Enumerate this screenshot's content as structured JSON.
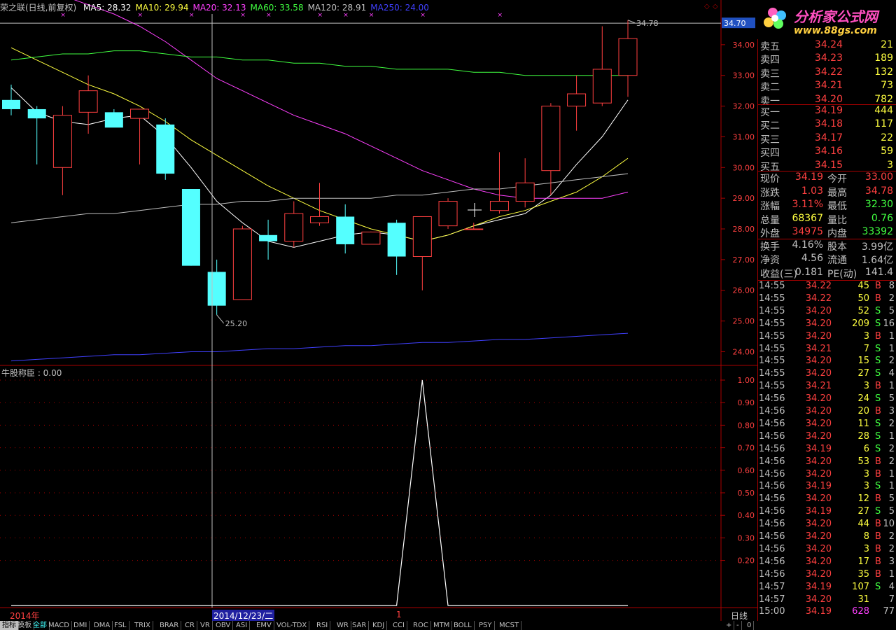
{
  "window": {
    "stock_title": "荣之联(日线,前复权)",
    "ma": [
      {
        "label": "MA5: 28.32",
        "color": "#ffffff"
      },
      {
        "label": "MA10: 29.94",
        "color": "#ffff40"
      },
      {
        "label": "MA20: 32.13",
        "color": "#ff40ff"
      },
      {
        "label": "MA60: 33.58",
        "color": "#40ff40"
      },
      {
        "label": "MA120: 28.91",
        "color": "#c0c0c0"
      },
      {
        "label": "MA250: 24.00",
        "color": "#4040ff"
      }
    ]
  },
  "price_axis": {
    "ticks": [
      "34.00",
      "33.00",
      "32.00",
      "31.00",
      "30.00",
      "29.00",
      "28.00",
      "27.00",
      "26.00",
      "25.00",
      "24.00"
    ],
    "current_marker": "34.70",
    "high_label": "34.78",
    "low_label": "25.20"
  },
  "indicator": {
    "title": "牛股称臣 : 0.00",
    "ticks": [
      "1.00",
      "0.90",
      "0.80",
      "0.70",
      "0.60",
      "0.50",
      "0.40",
      "0.30",
      "0.20"
    ],
    "series_values": [
      0,
      0,
      0,
      0,
      0,
      0,
      0,
      0,
      0,
      0,
      0,
      0,
      0,
      0,
      0,
      0,
      1,
      0,
      0,
      0,
      0,
      0,
      0,
      0,
      0
    ]
  },
  "date_axis": {
    "year_label": "2014年",
    "cursor_date": "2014/12/23/二",
    "month_label": "1",
    "period": "日线"
  },
  "chart_data": {
    "type": "candlestick",
    "title": "荣之联(日线,前复权)",
    "ylim": [
      23.6,
      35.0
    ],
    "candles": [
      {
        "o": 32.2,
        "h": 32.7,
        "l": 31.7,
        "c": 31.9
      },
      {
        "o": 31.9,
        "h": 32.0,
        "l": 30.1,
        "c": 31.6
      },
      {
        "o": 30.0,
        "h": 32.0,
        "l": 29.1,
        "c": 31.7
      },
      {
        "o": 31.8,
        "h": 33.0,
        "l": 31.1,
        "c": 32.5
      },
      {
        "o": 31.8,
        "h": 31.9,
        "l": 31.4,
        "c": 31.3
      },
      {
        "o": 31.6,
        "h": 31.8,
        "l": 30.1,
        "c": 31.9
      },
      {
        "o": 31.4,
        "h": 31.6,
        "l": 29.6,
        "c": 29.8
      },
      {
        "o": 29.3,
        "h": 29.3,
        "l": 26.8,
        "c": 26.8
      },
      {
        "o": 26.6,
        "h": 27.0,
        "l": 25.2,
        "c": 25.5
      },
      {
        "o": 25.7,
        "h": 28.1,
        "l": 25.7,
        "c": 28.0
      },
      {
        "o": 27.8,
        "h": 28.3,
        "l": 27.0,
        "c": 27.6
      },
      {
        "o": 27.6,
        "h": 28.9,
        "l": 27.4,
        "c": 28.5
      },
      {
        "o": 28.2,
        "h": 29.5,
        "l": 28.1,
        "c": 28.4
      },
      {
        "o": 28.4,
        "h": 28.8,
        "l": 27.2,
        "c": 27.5
      },
      {
        "o": 27.5,
        "h": 27.9,
        "l": 27.5,
        "c": 27.9
      },
      {
        "o": 28.2,
        "h": 28.3,
        "l": 26.5,
        "c": 27.1
      },
      {
        "o": 27.1,
        "h": 28.4,
        "l": 26.0,
        "c": 28.4
      },
      {
        "o": 28.1,
        "h": 29.0,
        "l": 28.0,
        "c": 28.9
      },
      {
        "o": 28.0,
        "h": 28.2,
        "l": 28.0,
        "c": 28.0
      },
      {
        "o": 28.6,
        "h": 30.5,
        "l": 28.5,
        "c": 28.9
      },
      {
        "o": 28.9,
        "h": 30.3,
        "l": 28.7,
        "c": 29.5
      },
      {
        "o": 29.9,
        "h": 32.1,
        "l": 29.1,
        "c": 32.0
      },
      {
        "o": 32.0,
        "h": 33.0,
        "l": 31.2,
        "c": 32.4
      },
      {
        "o": 32.1,
        "h": 34.6,
        "l": 32.0,
        "c": 33.2
      },
      {
        "o": 33.0,
        "h": 34.8,
        "l": 32.3,
        "c": 34.2
      }
    ],
    "ma_lines": [
      {
        "name": "MA5",
        "color": "#ffffff",
        "values": [
          32.6,
          31.8,
          31.5,
          31.4,
          31.6,
          31.7,
          31.0,
          30.0,
          28.9,
          28.2,
          27.6,
          27.4,
          27.6,
          27.8,
          27.9,
          27.8,
          27.6,
          27.8,
          28.1,
          28.3,
          28.5,
          29.1,
          30.1,
          31.0,
          32.2
        ]
      },
      {
        "name": "MA10",
        "color": "#ffff40",
        "values": [
          33.9,
          33.5,
          33.1,
          32.7,
          32.4,
          32.0,
          31.5,
          30.9,
          30.4,
          29.9,
          29.4,
          29.0,
          28.6,
          28.3,
          28.0,
          27.8,
          27.6,
          27.8,
          28.1,
          28.4,
          28.6,
          28.9,
          29.2,
          29.7,
          30.3
        ]
      },
      {
        "name": "MA20",
        "color": "#ff40ff",
        "values": [
          36.1,
          35.9,
          35.6,
          35.3,
          35.0,
          34.6,
          34.1,
          33.5,
          32.9,
          32.5,
          32.1,
          31.7,
          31.4,
          31.1,
          30.7,
          30.3,
          29.9,
          29.6,
          29.3,
          29.1,
          29.0,
          29.0,
          29.0,
          29.0,
          29.2
        ]
      },
      {
        "name": "MA60",
        "color": "#40ff40",
        "values": [
          33.5,
          33.6,
          33.7,
          33.7,
          33.8,
          33.8,
          33.7,
          33.6,
          33.6,
          33.5,
          33.5,
          33.4,
          33.4,
          33.3,
          33.3,
          33.2,
          33.2,
          33.2,
          33.1,
          33.1,
          33.0,
          33.0,
          33.0,
          33.0,
          33.0
        ]
      },
      {
        "name": "MA120",
        "color": "#c0c0c0",
        "values": [
          28.2,
          28.3,
          28.4,
          28.5,
          28.5,
          28.6,
          28.7,
          28.8,
          28.8,
          28.9,
          28.9,
          29.0,
          29.0,
          29.0,
          29.0,
          29.1,
          29.1,
          29.2,
          29.3,
          29.3,
          29.4,
          29.5,
          29.6,
          29.7,
          29.8
        ]
      },
      {
        "name": "MA250",
        "color": "#4040ff",
        "values": [
          23.7,
          23.75,
          23.8,
          23.85,
          23.9,
          23.9,
          23.95,
          24.0,
          24.0,
          24.05,
          24.1,
          24.1,
          24.15,
          24.2,
          24.2,
          24.25,
          24.3,
          24.3,
          24.35,
          24.4,
          24.4,
          24.45,
          24.5,
          24.55,
          24.6
        ]
      }
    ]
  },
  "quote": {
    "asks": [
      {
        "label": "卖五",
        "price": "34.24",
        "vol": "21"
      },
      {
        "label": "卖四",
        "price": "34.23",
        "vol": "189"
      },
      {
        "label": "卖三",
        "price": "34.22",
        "vol": "132"
      },
      {
        "label": "卖二",
        "price": "34.21",
        "vol": "73"
      },
      {
        "label": "卖一",
        "price": "34.20",
        "vol": "782"
      }
    ],
    "bids": [
      {
        "label": "买一",
        "price": "34.19",
        "vol": "444"
      },
      {
        "label": "买二",
        "price": "34.18",
        "vol": "117"
      },
      {
        "label": "买三",
        "price": "34.17",
        "vol": "22"
      },
      {
        "label": "买四",
        "price": "34.16",
        "vol": "59"
      },
      {
        "label": "买五",
        "price": "34.15",
        "vol": "3"
      }
    ],
    "stats1": [
      {
        "a": "现价",
        "b": "34.19",
        "bc": "red",
        "c": "今开",
        "d": "33.00",
        "dc": "red"
      },
      {
        "a": "涨跌",
        "b": "1.03",
        "bc": "red",
        "c": "最高",
        "d": "34.78",
        "dc": "red"
      },
      {
        "a": "涨幅",
        "b": "3.11%",
        "bc": "red",
        "c": "最低",
        "d": "32.30",
        "dc": "green"
      },
      {
        "a": "总量",
        "b": "68367",
        "bc": "yellow",
        "c": "量比",
        "d": "0.76",
        "dc": "green"
      },
      {
        "a": "外盘",
        "b": "34975",
        "bc": "red",
        "c": "内盘",
        "d": "33392",
        "dc": "green"
      }
    ],
    "stats2": [
      {
        "a": "换手",
        "b": "4.16%",
        "c": "股本",
        "d": "3.99亿"
      },
      {
        "a": "净资",
        "b": "4.56",
        "c": "流通",
        "d": "1.64亿"
      },
      {
        "a": "收益(三)",
        "b": "0.181",
        "c": "PE(动)",
        "d": "141.4"
      }
    ],
    "ticks": [
      {
        "t": "14:55",
        "p": "34.22",
        "v": "45",
        "s": "B",
        "n": "8"
      },
      {
        "t": "14:55",
        "p": "34.22",
        "v": "50",
        "s": "B",
        "n": "2"
      },
      {
        "t": "14:55",
        "p": "34.20",
        "v": "52",
        "s": "S",
        "n": "5"
      },
      {
        "t": "14:55",
        "p": "34.20",
        "v": "209",
        "s": "S",
        "n": "16"
      },
      {
        "t": "14:55",
        "p": "34.20",
        "v": "3",
        "s": "B",
        "n": "1"
      },
      {
        "t": "14:55",
        "p": "34.21",
        "v": "7",
        "s": "S",
        "n": "1"
      },
      {
        "t": "14:55",
        "p": "34.20",
        "v": "15",
        "s": "S",
        "n": "2"
      },
      {
        "t": "14:55",
        "p": "34.20",
        "v": "27",
        "s": "S",
        "n": "4"
      },
      {
        "t": "14:55",
        "p": "34.21",
        "v": "3",
        "s": "B",
        "n": "1"
      },
      {
        "t": "14:56",
        "p": "34.20",
        "v": "24",
        "s": "S",
        "n": "5"
      },
      {
        "t": "14:56",
        "p": "34.20",
        "v": "20",
        "s": "B",
        "n": "3"
      },
      {
        "t": "14:56",
        "p": "34.20",
        "v": "11",
        "s": "S",
        "n": "2"
      },
      {
        "t": "14:56",
        "p": "34.20",
        "v": "28",
        "s": "S",
        "n": "1"
      },
      {
        "t": "14:56",
        "p": "34.19",
        "v": "6",
        "s": "S",
        "n": "2"
      },
      {
        "t": "14:56",
        "p": "34.20",
        "v": "53",
        "s": "B",
        "n": "2"
      },
      {
        "t": "14:56",
        "p": "34.20",
        "v": "3",
        "s": "B",
        "n": "1"
      },
      {
        "t": "14:56",
        "p": "34.19",
        "v": "3",
        "s": "S",
        "n": "1"
      },
      {
        "t": "14:56",
        "p": "34.20",
        "v": "12",
        "s": "B",
        "n": "5"
      },
      {
        "t": "14:56",
        "p": "34.19",
        "v": "27",
        "s": "S",
        "n": "5"
      },
      {
        "t": "14:56",
        "p": "34.20",
        "v": "44",
        "s": "B",
        "n": "10"
      },
      {
        "t": "14:56",
        "p": "34.20",
        "v": "8",
        "s": "B",
        "n": "2"
      },
      {
        "t": "14:56",
        "p": "34.20",
        "v": "3",
        "s": "B",
        "n": "2"
      },
      {
        "t": "14:56",
        "p": "34.20",
        "v": "17",
        "s": "B",
        "n": "3"
      },
      {
        "t": "14:56",
        "p": "34.20",
        "v": "35",
        "s": "B",
        "n": "1"
      },
      {
        "t": "14:57",
        "p": "34.19",
        "v": "107",
        "s": "S",
        "n": "4"
      },
      {
        "t": "14:57",
        "p": "34.20",
        "v": "31",
        "s": "",
        "n": "7"
      },
      {
        "t": "15:00",
        "p": "34.19",
        "v": "628",
        "s": "",
        "n": "77"
      }
    ]
  },
  "tabs": [
    "指标",
    "模板",
    "全部",
    "MACD",
    "DMI",
    "DMA",
    "FSL",
    "TRIX",
    "BRAR",
    "CR",
    "VR",
    "OBV",
    "ASI",
    "EMV",
    "VOL-TDX",
    "RSI",
    "WR",
    "SAR",
    "KDJ",
    "CCI",
    "ROC",
    "MTM",
    "BOLL",
    "PSY",
    "MCST"
  ],
  "tab_controls": [
    "+",
    "-",
    "0"
  ],
  "logo": {
    "text": "分析家公式网",
    "url_text": "www.88gs.com"
  }
}
